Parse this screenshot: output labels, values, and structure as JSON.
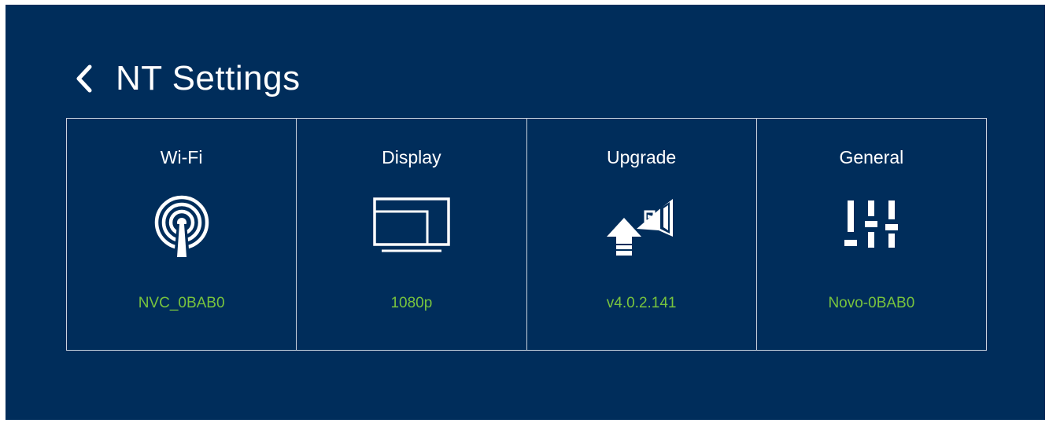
{
  "header": {
    "back_icon": "chevron-left-icon",
    "title": "NT Settings"
  },
  "tiles": [
    {
      "label": "Wi-Fi",
      "icon": "wifi-antenna-icon",
      "value": "NVC_0BAB0"
    },
    {
      "label": "Display",
      "icon": "monitor-icon",
      "value": "1080p"
    },
    {
      "label": "Upgrade",
      "icon": "upgrade-arrow-icon",
      "value": "v4.0.2.141"
    },
    {
      "label": "General",
      "icon": "sliders-icon",
      "value": "Novo-0BAB0"
    }
  ],
  "colors": {
    "background": "#002d5b",
    "text": "#ffffff",
    "value_text": "#78c43e",
    "border": "#c9d3df"
  }
}
